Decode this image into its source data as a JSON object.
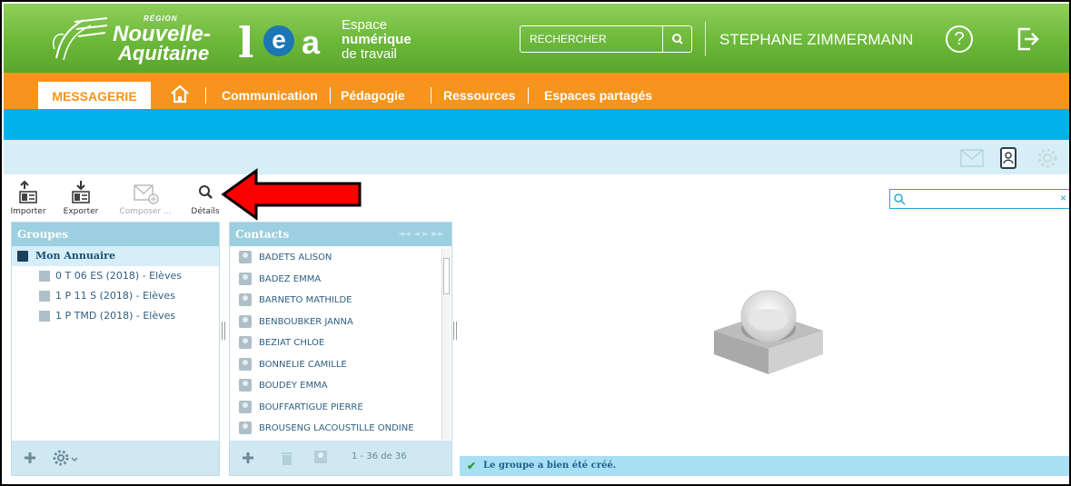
{
  "header": {
    "region_small": "RÉGION",
    "region_line1": "Nouvelle-",
    "region_line2": "Aquitaine",
    "lea_letters": [
      "l",
      "e",
      "a"
    ],
    "espace_line1": "Espace",
    "espace_line2": "numérique",
    "espace_line3": "de travail",
    "search_placeholder": "RECHERCHER",
    "search_icon": "search-icon",
    "user_name": "STEPHANE ZIMMERMANN",
    "help_icon": "help-icon",
    "logout_icon": "logout-icon"
  },
  "nav": {
    "active": "MESSAGERIE",
    "home_icon": "home-icon",
    "links": [
      "Communication",
      "Pédagogie",
      "Ressources",
      "Espaces partagés"
    ]
  },
  "lightbar_icons": [
    "mail-icon",
    "address-book-icon",
    "gear-icon"
  ],
  "toolbar": {
    "importer": "Importer",
    "exporter": "Exporter",
    "composer": "Composer ...",
    "details": "Détails",
    "filter_placeholder": "",
    "clear_icon": "clear-icon"
  },
  "groupes": {
    "title": "Groupes",
    "root": "Mon Annuaire",
    "items": [
      "0 T 06 ES (2018) - Elèves",
      "1 P 11 S (2018) - Elèves",
      "1 P TMD (2018) - Elèves"
    ]
  },
  "contacts": {
    "title": "Contacts",
    "items": [
      "BADETS ALISON",
      "BADEZ EMMA",
      "BARNETO MATHILDE",
      "BENBOUBKER JANNA",
      "BEZIAT CHLOE",
      "BONNELIE CAMILLE",
      "BOUDEY EMMA",
      "BOUFFARTIGUE PIERRE",
      "BROUSENG LACOUSTILLE ONDINE"
    ],
    "pagination": "1 - 36 de 36"
  },
  "status": {
    "message": "Le groupe a bien été créé.",
    "check_icon": "check-icon"
  },
  "colors": {
    "header_green": "#6cb83a",
    "nav_orange": "#f7941d",
    "blue_bar": "#00b2e8",
    "panel_head": "#9ccfe0",
    "arrow_red": "#ff0000"
  }
}
